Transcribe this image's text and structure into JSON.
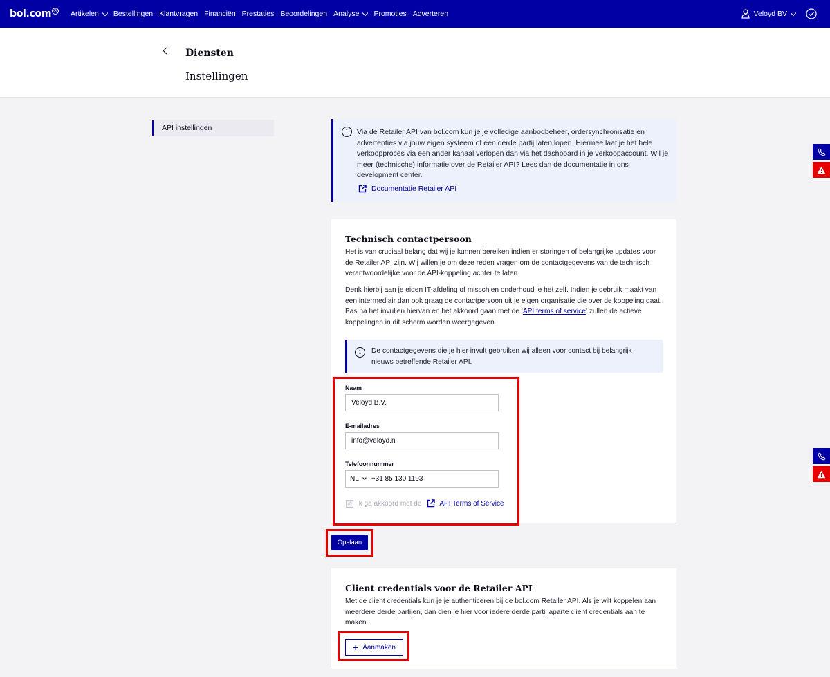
{
  "nav": {
    "logo": "bol.com",
    "logo_mark": "®",
    "items": [
      {
        "label": "Artikelen",
        "dropdown": true
      },
      {
        "label": "Bestellingen",
        "dropdown": false
      },
      {
        "label": "Klantvragen",
        "dropdown": false
      },
      {
        "label": "Financiën",
        "dropdown": false
      },
      {
        "label": "Prestaties",
        "dropdown": false
      },
      {
        "label": "Beoordelingen",
        "dropdown": false
      },
      {
        "label": "Analyse",
        "dropdown": true
      },
      {
        "label": "Promoties",
        "dropdown": false
      },
      {
        "label": "Adverteren",
        "dropdown": false
      }
    ],
    "account": "Veloyd BV"
  },
  "header": {
    "title": "Diensten",
    "subtitle": "Instellingen"
  },
  "sidebar": {
    "items": [
      {
        "label": "API instellingen"
      }
    ]
  },
  "info": {
    "text": "Via de Retailer API van bol.com kun je je volledige aanbodbeheer, ordersynchronisatie en advertenties via jouw eigen systeem of een derde partij laten lopen. Hiermee laat je het hele verkoopproces via een ander kanaal verlopen dan via het dashboard in je verkoopaccount. Wil je meer (technische) informatie over de Retailer API? Lees dan de documentatie in ons development center.",
    "link": "Documentatie Retailer API"
  },
  "contact": {
    "title": "Technisch contactpersoon",
    "para1": "Het is van cruciaal belang dat wij je kunnen bereiken indien er storingen of belangrijke updates voor de Retailer API zijn. Wij willen je om deze reden vragen om de contactgegevens van de technisch verantwoordelijke voor de API-koppeling achter te laten.",
    "para2_a": "Denk hierbij aan je eigen IT-afdeling of misschien onderhoud je het zelf. Indien je gebruik maakt van een intermediair dan ook graag de contactpersoon uit je eigen organisatie die over de koppeling gaat. Pas na het invullen hiervan en het akkoord gaan met de '",
    "para2_link": "API terms of service",
    "para2_b": "' zullen de actieve koppelingen in dit scherm worden weergegeven.",
    "notice": "De contactgegevens die je hier invult gebruiken wij alleen voor contact bij belangrijk nieuws betreffende Retailer API.",
    "name_label": "Naam",
    "name_value": "Veloyd B.V.",
    "email_label": "E-mailadres",
    "email_value": "info@veloyd.nl",
    "phone_label": "Telefoonnummer",
    "phone_country": "NL",
    "phone_value": "+31 85 130 1193",
    "agree_text": "Ik ga akkoord met de",
    "agree_link": "API Terms of Service",
    "agree_checked": true
  },
  "save_label": "Opslaan",
  "credentials": {
    "title": "Client credentials voor de Retailer API",
    "para": "Met de client credentials kun je je authenticeren bij de bol.com Retailer API. Als je wilt koppelen aan meerdere derde partijen, dan dien je hier voor iedere derde partij aparte client credentials aan te maken.",
    "add_label": "Aanmaken"
  },
  "colors": {
    "brand": "#0000a4",
    "highlight": "#e60000",
    "info_bg": "#ecf1fb"
  }
}
